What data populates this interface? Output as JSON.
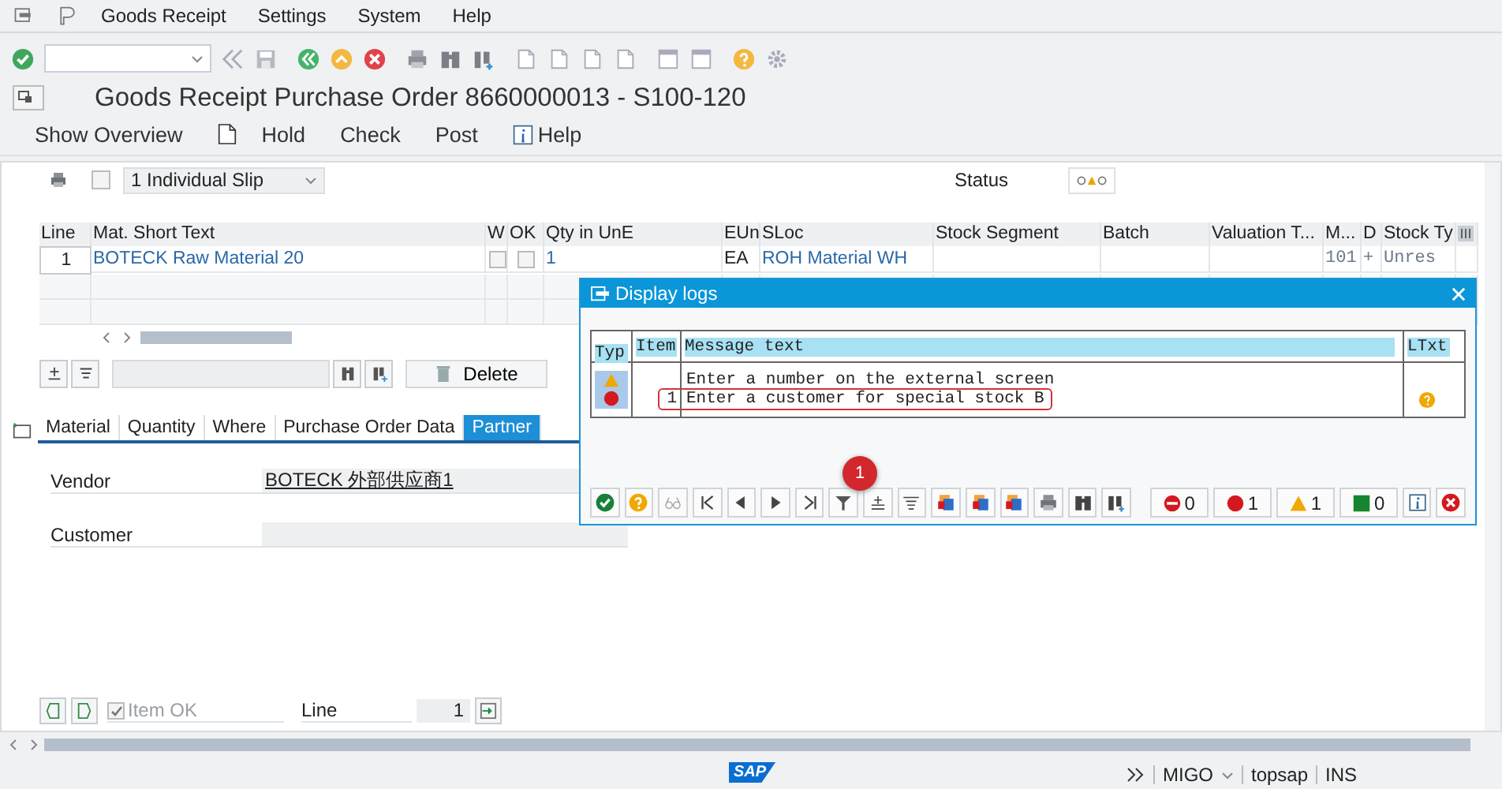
{
  "menu_bar": {
    "items": [
      "Goods Receipt",
      "Settings",
      "System",
      "Help"
    ]
  },
  "title": "Goods Receipt Purchase Order 8660000013 - S100-120",
  "app_toolbar": [
    {
      "kind": "button",
      "label": "Show Overview"
    },
    {
      "kind": "document"
    },
    {
      "kind": "button",
      "label": "Hold"
    },
    {
      "kind": "button",
      "label": "Check"
    },
    {
      "kind": "button",
      "label": "Post"
    },
    {
      "kind": "info",
      "label": "Help"
    }
  ],
  "print_options": {
    "checked": false,
    "slip": "1 Individual Slip"
  },
  "status": {
    "label": "Status"
  },
  "items_table": {
    "columns": [
      "Line",
      "Mat. Short Text",
      "W",
      "OK",
      "Qty in UnE",
      "EUn",
      "SLoc",
      "Stock Segment",
      "Batch",
      "Valuation T...",
      "M...",
      "D",
      "Stock Ty"
    ],
    "rows": [
      {
        "line": "1",
        "mat_short_text": "BOTECK Raw Material 20",
        "w": false,
        "ok": false,
        "qty": "1",
        "eun": "EA",
        "sloc": "ROH Material WH",
        "mvt": "101",
        "d": "+",
        "stock_type": "Unres"
      }
    ]
  },
  "table_toolbar": {
    "delete": "Delete"
  },
  "tabs": [
    {
      "label": "Material",
      "selected": false
    },
    {
      "label": "Quantity",
      "selected": false
    },
    {
      "label": "Where",
      "selected": false
    },
    {
      "label": "Purchase Order Data",
      "selected": false
    },
    {
      "label": "Partner",
      "selected": true
    }
  ],
  "partner_fields": [
    {
      "label": "Vendor",
      "value": "BOTECK 外部供应商1"
    },
    {
      "label": "Customer"
    }
  ],
  "footer": {
    "item_ok": {
      "label": "Item OK",
      "checked": true,
      "disabled": true
    },
    "line": {
      "label": "Line",
      "value": "1"
    }
  },
  "status_bar": {
    "logo": "SAP",
    "transaction": "MIGO",
    "user": "topsap",
    "mode": "INS"
  },
  "popup": {
    "title": "Display logs",
    "columns": [
      "Typ",
      "Item",
      "Message text",
      "LTxt"
    ],
    "messages": [
      {
        "kind": "warning",
        "text": "Enter a number on the external screen",
        "highlighted": false,
        "long_text": false
      },
      {
        "kind": "error",
        "item": "1",
        "text": "Enter a customer for special stock B",
        "highlighted": true,
        "long_text": true
      }
    ],
    "badge": "1",
    "counters": [
      {
        "kind": "stop",
        "count": "0"
      },
      {
        "kind": "error",
        "count": "1"
      },
      {
        "kind": "warning",
        "count": "1"
      },
      {
        "kind": "success",
        "count": "0"
      }
    ]
  }
}
